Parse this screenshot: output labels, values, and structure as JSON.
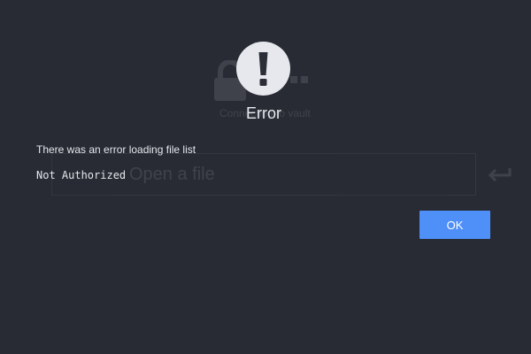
{
  "background": {
    "caption": "Connecting to vault",
    "input_placeholder": "Open a file"
  },
  "dialog": {
    "icon": "exclamation-icon",
    "title": "Error",
    "message": "There was an error loading file list",
    "detail": "Not Authorized",
    "ok_label": "OK"
  },
  "colors": {
    "background": "#282b33",
    "accent": "#4f8ff8",
    "text": "#e8eaef"
  }
}
